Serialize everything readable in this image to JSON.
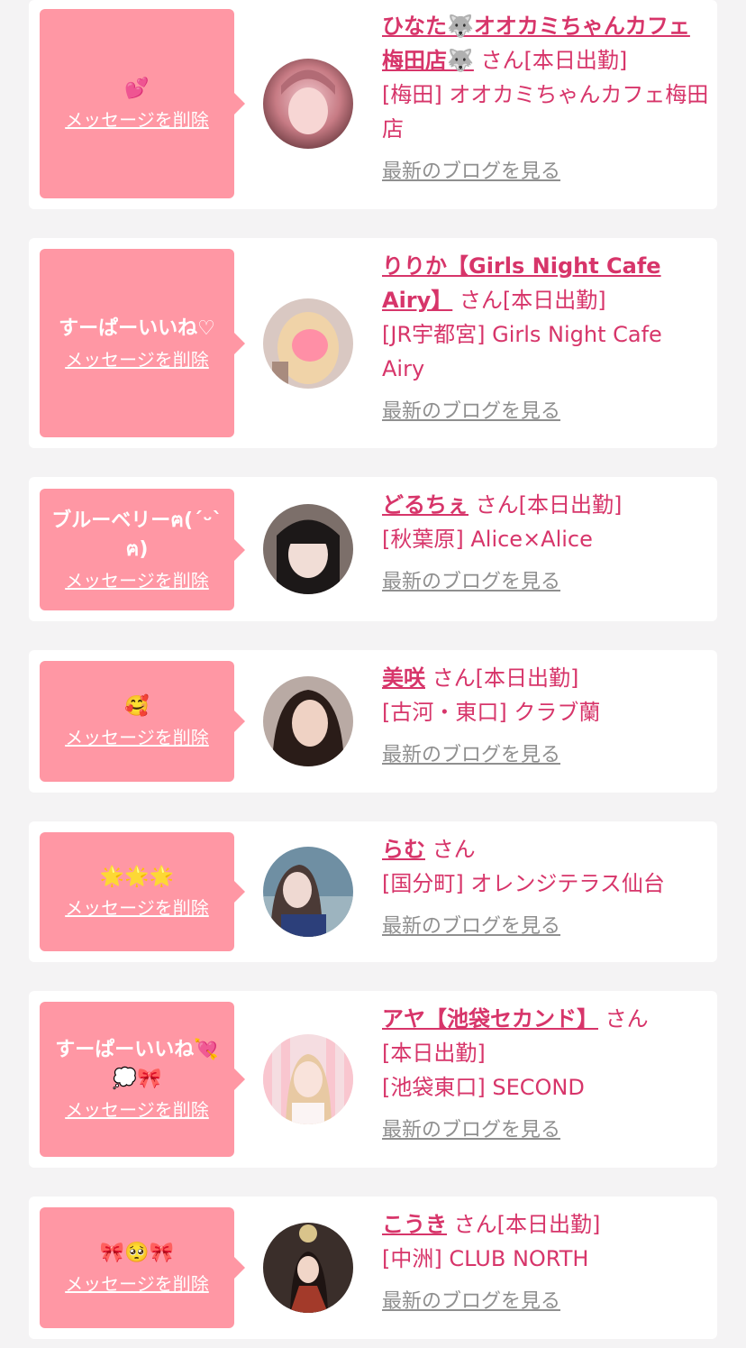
{
  "colors": {
    "accent": "#d7356a",
    "bubble": "#ff97a4",
    "background": "#f4f3f4",
    "link_gray": "#8f8f8f"
  },
  "common": {
    "delete_label": "メッセージを削除",
    "blog_label": "最新のブログを見る",
    "san": "さん",
    "today_label": "[本日出勤]"
  },
  "cards": [
    {
      "message": "💕",
      "name": "ひなた🐺オオカミちゃんカフェ梅田店🐺",
      "today": "[本日出勤]",
      "location": "[梅田] オオカミちゃんカフェ梅田店",
      "avatar_icon": "avatar-photo"
    },
    {
      "message": "すーぱーいいね♡",
      "name": "りりか【Girls Night Cafe Airy】",
      "today": "[本日出勤]",
      "location": "[JR宇都宮] Girls Night Cafe Airy",
      "avatar_icon": "avatar-photo"
    },
    {
      "message": "ブルーベリーฅ(ˊᵕˋ ฅ)",
      "name": "どるちぇ",
      "today": "[本日出勤]",
      "location": "[秋葉原] Alice×Alice",
      "avatar_icon": "avatar-photo"
    },
    {
      "message": "🥰",
      "name": "美咲",
      "today": "[本日出勤]",
      "location": "[古河・東口] クラブ蘭",
      "avatar_icon": "avatar-photo"
    },
    {
      "message": "🌟🌟🌟",
      "name": "らむ",
      "today": "",
      "location": "[国分町] オレンジテラス仙台",
      "avatar_icon": "avatar-photo"
    },
    {
      "message": "すーぱーいいね💘💭🎀",
      "name": "アヤ【池袋セカンド】",
      "today": "[本日出勤]",
      "location": "[池袋東口] SECOND",
      "avatar_icon": "avatar-photo"
    },
    {
      "message": "🎀🥺🎀",
      "name": "こうき",
      "today": "[本日出勤]",
      "location": "[中洲] CLUB NORTH",
      "avatar_icon": "avatar-photo"
    }
  ]
}
